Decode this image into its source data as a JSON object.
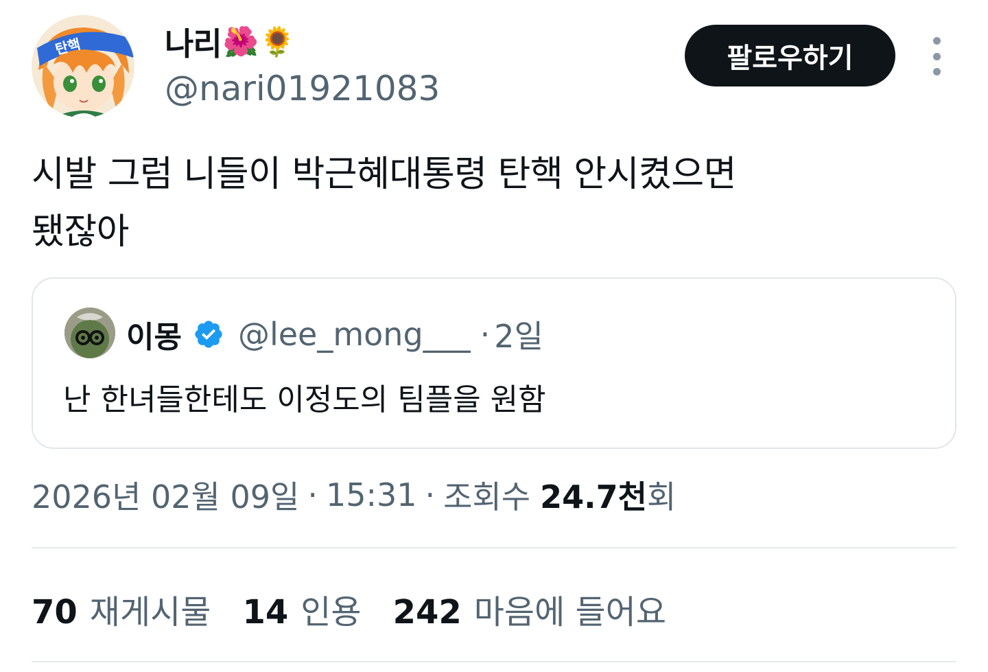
{
  "author": {
    "display_name": "나리",
    "emoji_1": "🌺",
    "emoji_2": "🌻",
    "handle": "@nari01921083",
    "avatar_badge_text": "탄핵"
  },
  "follow_button_label": "팔로우하기",
  "more_icon": "more-vertical-icon",
  "tweet": {
    "text_line1": "시발 그럼 니들이 박근혜대통령 탄핵 안시켰으면",
    "text_line2": "됐잖아"
  },
  "quote": {
    "name": "이몽",
    "handle": "@lee_mong___",
    "separator": "·",
    "time": "2일",
    "text": "난 한녀들한테도 이정도의 팀플을 원함",
    "verified_icon": "verified-badge-icon"
  },
  "meta": {
    "date": "2026년 02월 09일",
    "separator": "·",
    "time": "15:31",
    "views_label": "조회수",
    "views_value": "24.7천",
    "views_suffix": "회"
  },
  "stats": {
    "reposts_count": "70",
    "reposts_label": "재게시물",
    "quotes_count": "14",
    "quotes_label": "인용",
    "likes_count": "242",
    "likes_label": "마음에 들어요"
  },
  "colors": {
    "text_primary": "#0f1419",
    "text_secondary": "#536471",
    "border": "#e1e6ea",
    "verified_blue": "#1d9bf0",
    "button_bg": "#0f1419"
  }
}
